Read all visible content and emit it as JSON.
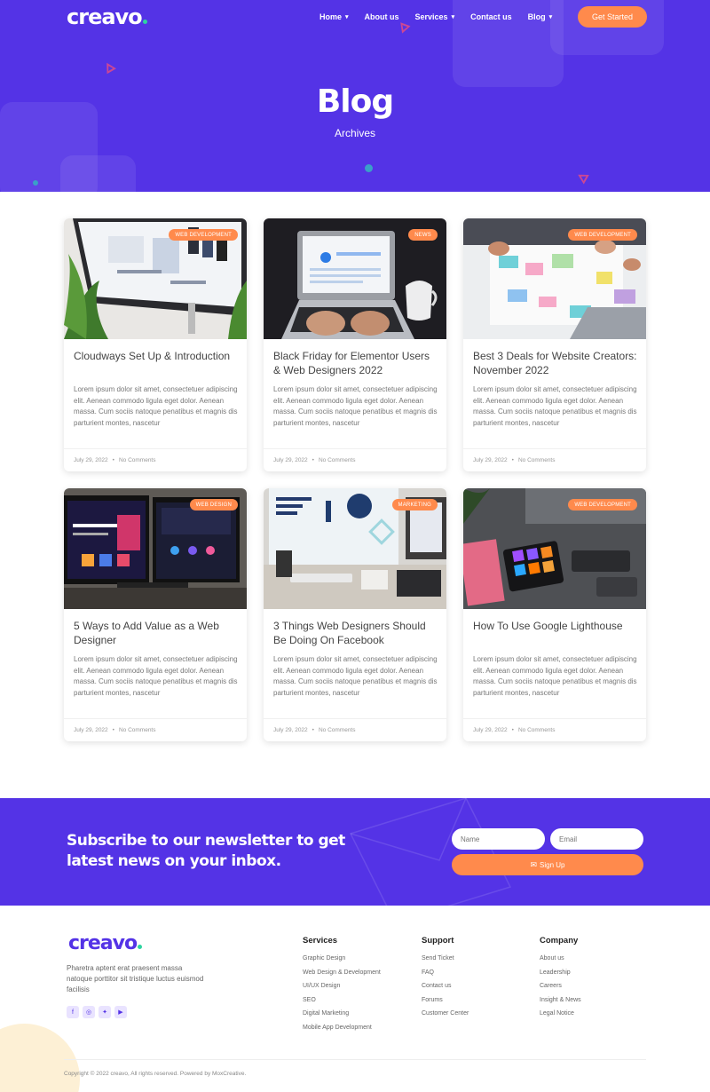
{
  "header": {
    "logo": "creavo",
    "nav": [
      {
        "label": "Home",
        "has_dropdown": true
      },
      {
        "label": "About us",
        "has_dropdown": false
      },
      {
        "label": "Services",
        "has_dropdown": true
      },
      {
        "label": "Contact us",
        "has_dropdown": false
      },
      {
        "label": "Blog",
        "has_dropdown": true
      }
    ],
    "cta_label": "Get Started"
  },
  "hero": {
    "title": "Blog",
    "subtitle": "Archives"
  },
  "posts": [
    {
      "category": "Web Development",
      "title": "Cloudways Set Up & Introduction",
      "excerpt": "Lorem ipsum dolor sit amet, consectetuer adipiscing elit. Aenean commodo ligula eget dolor. Aenean massa. Cum sociis natoque penatibus et magnis dis parturient montes, nascetur",
      "date": "July 29, 2022",
      "comments": "No Comments"
    },
    {
      "category": "News",
      "title": "Black Friday for Elementor Users & Web Designers 2022",
      "excerpt": "Lorem ipsum dolor sit amet, consectetuer adipiscing elit. Aenean commodo ligula eget dolor. Aenean massa. Cum sociis natoque penatibus et magnis dis parturient montes, nascetur",
      "date": "July 29, 2022",
      "comments": "No Comments"
    },
    {
      "category": "Web Development",
      "title": "Best 3 Deals for Website Creators: November 2022",
      "excerpt": "Lorem ipsum dolor sit amet, consectetuer adipiscing elit. Aenean commodo ligula eget dolor. Aenean massa. Cum sociis natoque penatibus et magnis dis parturient montes, nascetur",
      "date": "July 29, 2022",
      "comments": "No Comments"
    },
    {
      "category": "Web Design",
      "title": "5 Ways to Add Value as a Web Designer",
      "excerpt": "Lorem ipsum dolor sit amet, consectetuer adipiscing elit. Aenean commodo ligula eget dolor. Aenean massa. Cum sociis natoque penatibus et magnis dis parturient montes, nascetur",
      "date": "July 29, 2022",
      "comments": "No Comments"
    },
    {
      "category": "Marketing",
      "title": "3 Things Web Designers Should Be Doing On Facebook",
      "excerpt": "Lorem ipsum dolor sit amet, consectetuer adipiscing elit. Aenean commodo ligula eget dolor. Aenean massa. Cum sociis natoque penatibus et magnis dis parturient montes, nascetur",
      "date": "July 29, 2022",
      "comments": "No Comments"
    },
    {
      "category": "Web Development",
      "title": "How To Use Google Lighthouse",
      "excerpt": "Lorem ipsum dolor sit amet, consectetuer adipiscing elit. Aenean commodo ligula eget dolor. Aenean massa. Cum sociis natoque penatibus et magnis dis parturient montes, nascetur",
      "date": "July 29, 2022",
      "comments": "No Comments"
    }
  ],
  "newsletter": {
    "title": "Subscribe to our newsletter to get latest news on your inbox.",
    "name_placeholder": "Name",
    "email_placeholder": "Email",
    "button_label": "Sign Up"
  },
  "footer": {
    "logo": "creavo",
    "about": "Pharetra aptent erat praesent massa natoque porttitor sit tristique luctus euismod facilisis",
    "social": [
      "facebook-icon",
      "instagram-icon",
      "twitter-icon",
      "youtube-icon"
    ],
    "columns": [
      {
        "heading": "Services",
        "links": [
          "Graphic Design",
          "Web Design & Development",
          "UI/UX Design",
          "SEO",
          "Digital Marketing",
          "Mobile App Development"
        ]
      },
      {
        "heading": "Support",
        "links": [
          "Send Ticket",
          "FAQ",
          "Contact us",
          "Forums",
          "Customer Center"
        ]
      },
      {
        "heading": "Company",
        "links": [
          "About us",
          "Leadership",
          "Careers",
          "Insight & News",
          "Legal Notice"
        ]
      }
    ],
    "copyright": "Copyright © 2022 creavo, All rights reserved. Powered by MoxCreative."
  },
  "colors": {
    "primary": "#5433e6",
    "accent": "#ff8a4c",
    "logo_dot": "#2ed3a0"
  }
}
